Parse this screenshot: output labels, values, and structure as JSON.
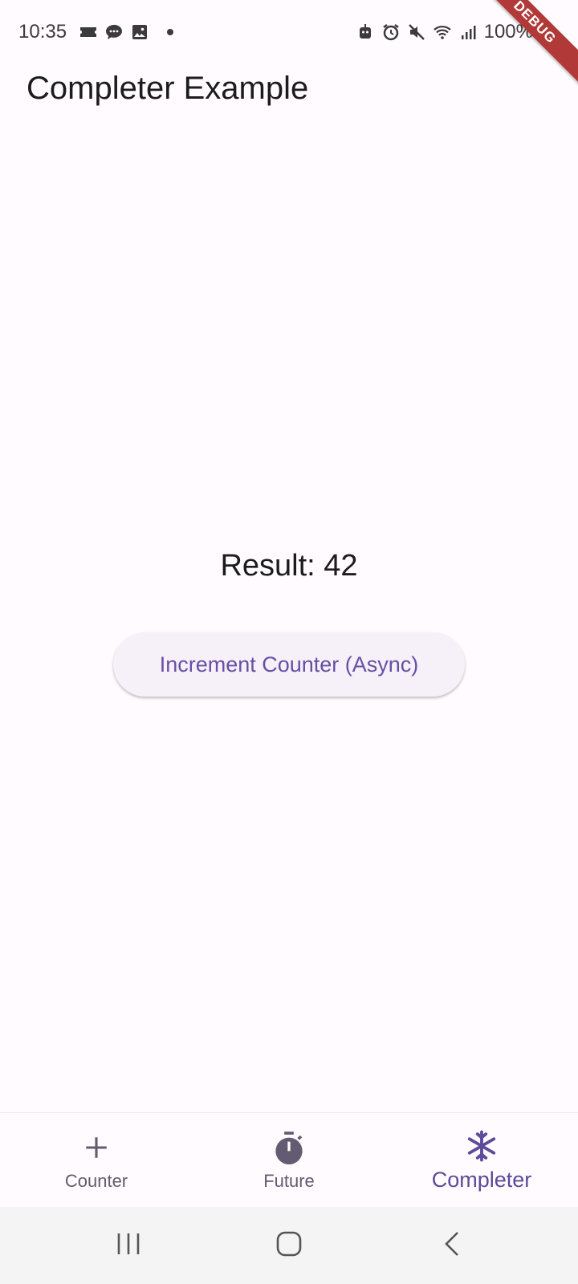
{
  "status_bar": {
    "time": "10:35",
    "battery": "100%",
    "left_icons": [
      "ticket-icon",
      "chat-icon",
      "image-icon",
      "dot-icon"
    ],
    "right_icons": [
      "bot-icon",
      "alarm-icon",
      "mute-icon",
      "wifi-icon",
      "signal-icon",
      "battery-icon"
    ]
  },
  "debug_banner": "DEBUG",
  "app_bar": {
    "title": "Completer Example"
  },
  "main": {
    "result": "Result: 42",
    "button_label": "Increment Counter (Async)"
  },
  "bottom_nav": {
    "items": [
      {
        "label": "Counter",
        "icon": "plus-icon",
        "active": false
      },
      {
        "label": "Future",
        "icon": "timer-icon",
        "active": false
      },
      {
        "label": "Completer",
        "icon": "snowflake-icon",
        "active": true
      }
    ]
  },
  "system_nav": [
    "recents-button",
    "home-button",
    "back-button"
  ],
  "colors": {
    "background": "#fffbfe",
    "accent": "#6750a4",
    "active_nav": "#5b4b9a",
    "inactive_nav": "#625b71",
    "button_bg": "#f6f0f8",
    "debug_banner": "#b13a39"
  }
}
